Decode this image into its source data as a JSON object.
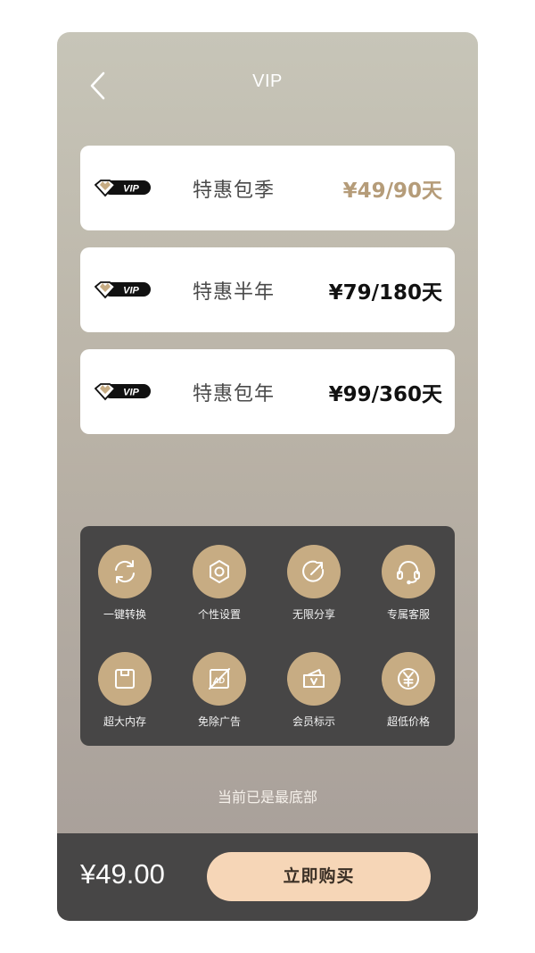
{
  "header": {
    "back_icon": "chevron-left-icon",
    "title": "VIP"
  },
  "plans": [
    {
      "badge_text": "VIP",
      "name": "特惠包季",
      "price": "¥49/90天",
      "selected": true
    },
    {
      "badge_text": "VIP",
      "name": "特惠半年",
      "price": "¥79/180天",
      "selected": false
    },
    {
      "badge_text": "VIP",
      "name": "特惠包年",
      "price": "¥99/360天",
      "selected": false
    }
  ],
  "features": [
    {
      "icon": "sync-icon",
      "label": "一键转换"
    },
    {
      "icon": "hexagon-nut-icon",
      "label": "个性设置"
    },
    {
      "icon": "share-arrow-icon",
      "label": "无限分享"
    },
    {
      "icon": "headset-icon",
      "label": "专属客服"
    },
    {
      "icon": "storage-icon",
      "label": "超大内存"
    },
    {
      "icon": "no-ads-icon",
      "label": "免除广告"
    },
    {
      "icon": "vip-tag-icon",
      "label": "会员标示"
    },
    {
      "icon": "yen-coin-icon",
      "label": "超低价格"
    }
  ],
  "bottom_note": "当前已是最底部",
  "footer": {
    "total": "¥49.00",
    "buy_label": "立即购买"
  },
  "colors": {
    "gold": "#c7ac83",
    "selected_price": "#b59c79",
    "panel": "#474646",
    "buy_button": "#f6d6b7"
  }
}
